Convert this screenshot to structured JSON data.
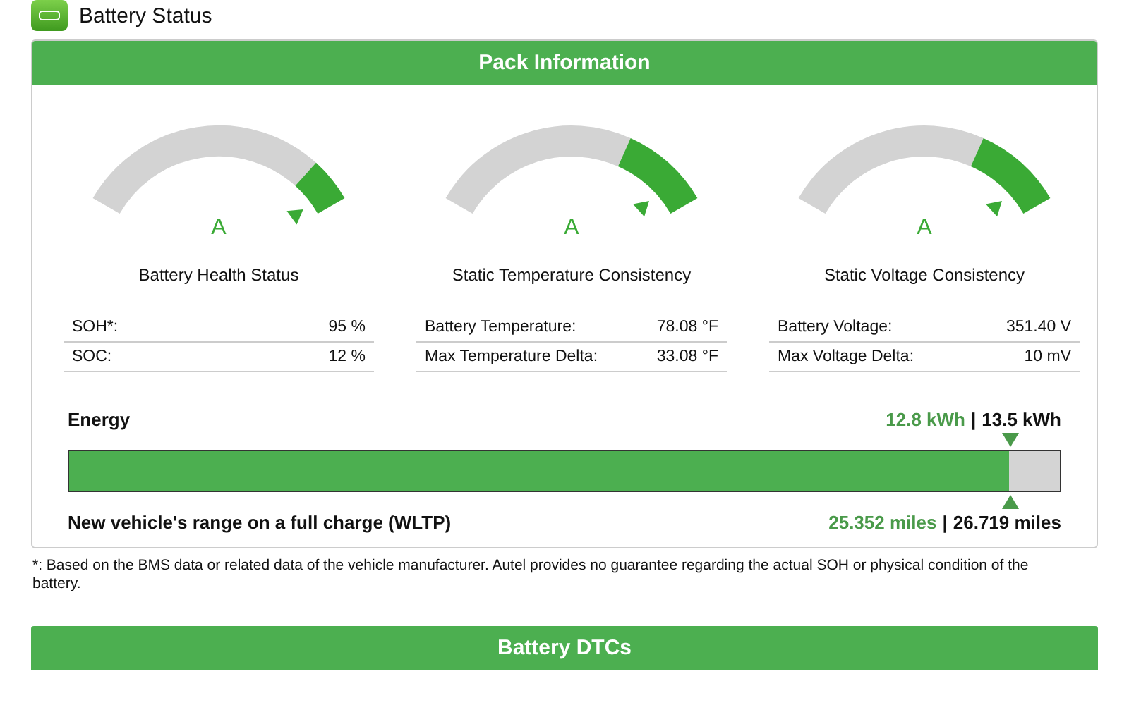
{
  "page_title": "Battery Status",
  "pack": {
    "title": "Pack Information",
    "gauges": [
      {
        "title": "Battery Health Status",
        "grade": "A",
        "rows": [
          {
            "label": "SOH*:",
            "value": "95 %"
          },
          {
            "label": "SOC:",
            "value": "12 %"
          }
        ]
      },
      {
        "title": "Static Temperature Consistency",
        "grade": "A",
        "rows": [
          {
            "label": "Battery Temperature:",
            "value": "78.08 °F"
          },
          {
            "label": "Max Temperature Delta:",
            "value": "33.08 °F"
          }
        ]
      },
      {
        "title": "Static Voltage Consistency",
        "grade": "A",
        "rows": [
          {
            "label": "Battery Voltage:",
            "value": "351.40 V"
          },
          {
            "label": "Max Voltage Delta:",
            "value": "10 mV"
          }
        ]
      }
    ],
    "energy": {
      "label": "Energy",
      "current": "12.8 kWh",
      "separator": "|",
      "total": "13.5 kWh",
      "level": 0.949,
      "range_label": "New vehicle's range on a full charge (WLTP)",
      "range_current": "25.352 miles",
      "range_total": "26.719 miles"
    }
  },
  "footnote": "*: Based on the BMS data or related data of the vehicle manufacturer. Autel provides no guarantee regarding the actual SOH or physical condition of the battery.",
  "dtc": {
    "title": "Battery DTCs"
  }
}
